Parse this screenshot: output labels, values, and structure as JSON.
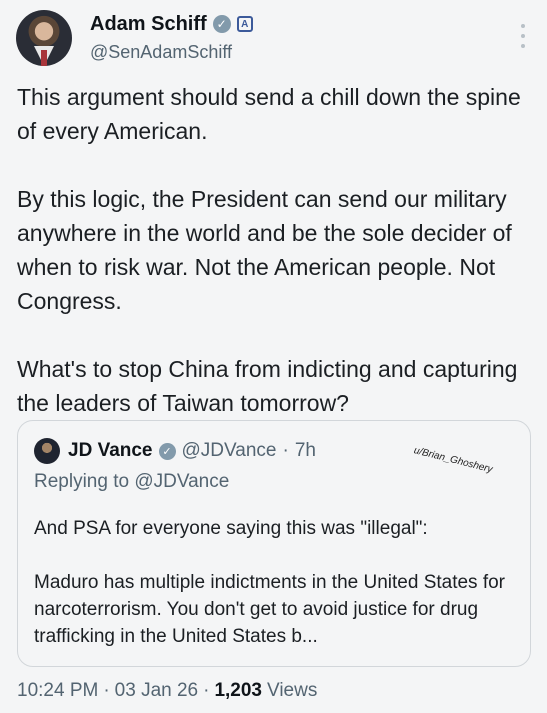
{
  "author": {
    "display_name": "Adam Schiff",
    "handle": "@SenAdamSchiff",
    "verified_badge_icon": "verified-badge-icon",
    "affiliation_icon": "government-badge-icon",
    "gov_badge_glyph": "A"
  },
  "menu": {
    "icon": "more-vertical-icon"
  },
  "post": {
    "text": "This argument should send a chill down the spine of every American.\n\nBy this logic, the President can send our military anywhere in the world and be the sole decider of when to risk war. Not the American people. Not Congress.\n\nWhat's to stop China from indicting and capturing the leaders of Taiwan tomorrow?"
  },
  "quote": {
    "display_name": "JD Vance",
    "handle": "@JDVance",
    "separator": "·",
    "time": "7h",
    "replying_to": "Replying to @JDVance",
    "text": "And PSA for everyone saying this was \"illegal\":\n\nMaduro has multiple indictments in the United States for narcoterrorism. You don't get to avoid justice for drug trafficking in the United States b...",
    "watermark": "u/Brian_Ghoshery"
  },
  "meta": {
    "time": "10:24 PM",
    "sep1": "·",
    "date": "03 Jan 26",
    "sep2": "·",
    "views_count": "1,203",
    "views_label": "Views"
  },
  "colors": {
    "background": "#f4f5f6",
    "secondary_text": "#536471",
    "verified_badge": "#829aab",
    "gov_badge": "#3c5a9a"
  }
}
